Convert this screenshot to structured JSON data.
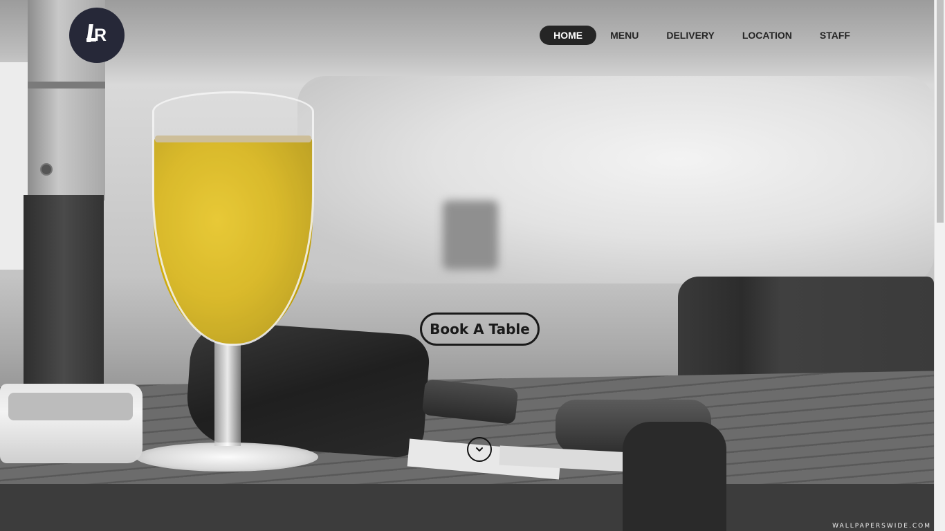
{
  "brand": {
    "logo_text": "LR"
  },
  "nav": {
    "items": [
      {
        "label": "HOME",
        "active": true
      },
      {
        "label": "MENU",
        "active": false
      },
      {
        "label": "DELIVERY",
        "active": false
      },
      {
        "label": "LOCATION",
        "active": false
      },
      {
        "label": "STAFF",
        "active": false
      }
    ]
  },
  "hero": {
    "cta_label": "Book A Table",
    "scroll_icon": "chevron-down-icon",
    "watermark": "WALLPAPERSWIDE.COM"
  },
  "colors": {
    "nav_active_bg": "#252525",
    "logo_bg": "#262838",
    "juice": "#d4b00e"
  }
}
